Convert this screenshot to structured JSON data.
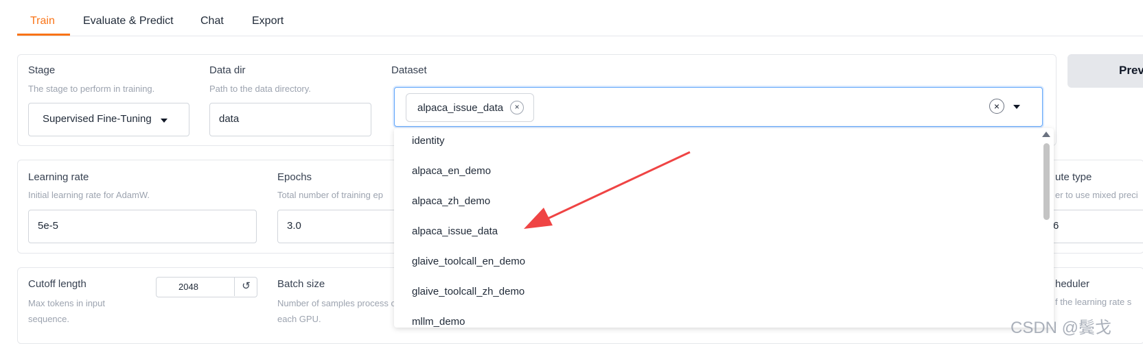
{
  "tabs": {
    "train": "Train",
    "evaluate": "Evaluate & Predict",
    "chat": "Chat",
    "export": "Export"
  },
  "stage": {
    "label": "Stage",
    "info": "The stage to perform in training.",
    "value": "Supervised Fine-Tuning"
  },
  "data_dir": {
    "label": "Data dir",
    "info": "Path to the data directory.",
    "value": "data"
  },
  "dataset": {
    "label": "Dataset",
    "selected_chip": "alpaca_issue_data",
    "chip_remove": "×",
    "clear": "×",
    "options": [
      "identity",
      "alpaca_en_demo",
      "alpaca_zh_demo",
      "alpaca_issue_data",
      "glaive_toolcall_en_demo",
      "glaive_toolcall_zh_demo",
      "mllm_demo"
    ]
  },
  "preview_button": "Prev",
  "learning_rate": {
    "label": "Learning rate",
    "info": "Initial learning rate for AdamW.",
    "value": "5e-5"
  },
  "epochs": {
    "label": "Epochs",
    "info": "Total number of training ep",
    "value": "3.0"
  },
  "compute_type": {
    "label": "ute type",
    "info": "er to use mixed preci",
    "value": "6"
  },
  "cutoff_length": {
    "label": "Cutoff length",
    "info": "Max tokens in input sequence.",
    "value": "2048",
    "reset": "↺"
  },
  "batch_size": {
    "label": "Batch size",
    "info": "Number of samples process on each GPU."
  },
  "scheduler": {
    "label": "heduler",
    "info": "f the learning rate s"
  },
  "watermark": "CSDN @鬓戈",
  "colors": {
    "accent": "#f97316",
    "focus": "#60a5fa",
    "arrow": "#ef4444"
  }
}
